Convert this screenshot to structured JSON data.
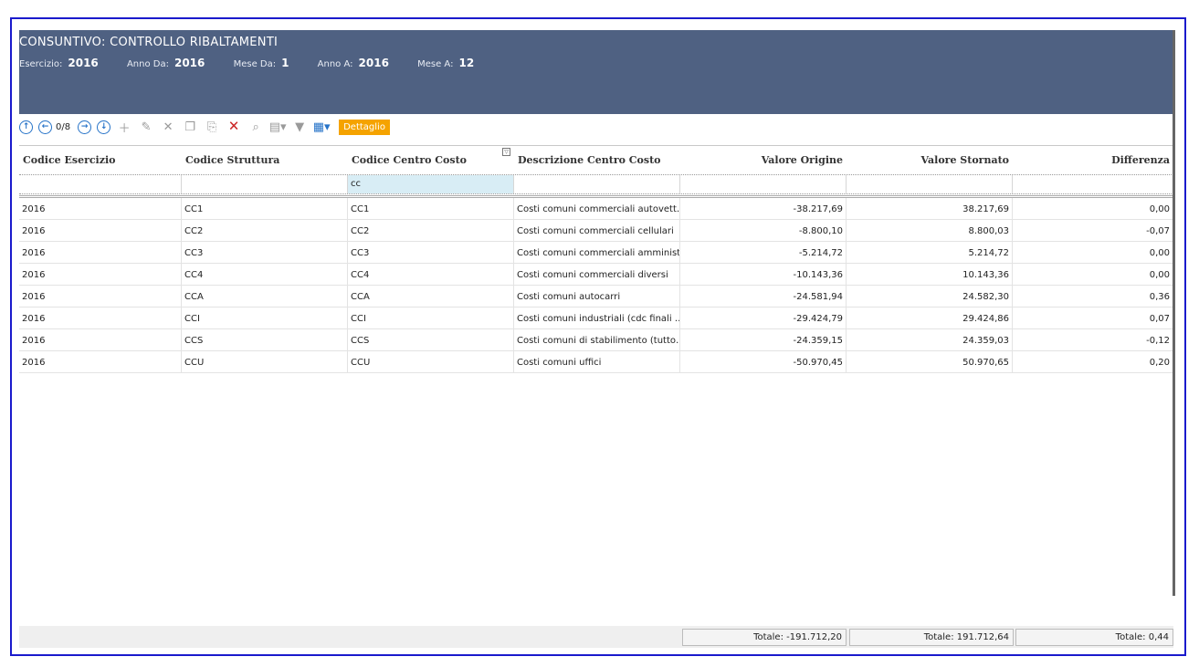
{
  "header": {
    "title": "CONSUNTIVO: CONTROLLO RIBALTAMENTI",
    "params": [
      {
        "label": "Esercizio:",
        "value": "2016"
      },
      {
        "label": "Anno Da:",
        "value": "2016"
      },
      {
        "label": "Mese Da:",
        "value": "1"
      },
      {
        "label": "Anno A:",
        "value": "2016"
      },
      {
        "label": "Mese A:",
        "value": "12"
      }
    ]
  },
  "toolbar": {
    "counter": "0/8",
    "dettaglio_label": "Dettaglio"
  },
  "columns": [
    "Codice Esercizio",
    "Codice Struttura",
    "Codice Centro Costo",
    "Descrizione Centro Costo",
    "Valore Origine",
    "Valore Stornato",
    "Differenza"
  ],
  "filter": {
    "codice_centro_costo": "cc"
  },
  "rows": [
    [
      "2016",
      "CC1",
      "CC1",
      "Costi comuni commerciali autovett…",
      "-38.217,69",
      "38.217,69",
      "0,00"
    ],
    [
      "2016",
      "CC2",
      "CC2",
      "Costi comuni commerciali cellulari",
      "-8.800,10",
      "8.800,03",
      "-0,07"
    ],
    [
      "2016",
      "CC3",
      "CC3",
      "Costi comuni commerciali amminist…",
      "-5.214,72",
      "5.214,72",
      "0,00"
    ],
    [
      "2016",
      "CC4",
      "CC4",
      "Costi comuni commerciali diversi",
      "-10.143,36",
      "10.143,36",
      "0,00"
    ],
    [
      "2016",
      "CCA",
      "CCA",
      "Costi comuni autocarri",
      "-24.581,94",
      "24.582,30",
      "0,36"
    ],
    [
      "2016",
      "CCI",
      "CCI",
      "Costi comuni industriali (cdc finali …",
      "-29.424,79",
      "29.424,86",
      "0,07"
    ],
    [
      "2016",
      "CCS",
      "CCS",
      "Costi comuni di stabilimento (tutto…",
      "-24.359,15",
      "24.359,03",
      "-0,12"
    ],
    [
      "2016",
      "CCU",
      "CCU",
      "Costi comuni uffici",
      "-50.970,45",
      "50.970,65",
      "0,20"
    ]
  ],
  "totals": {
    "valore_origine": "Totale: -191.712,20",
    "valore_stornato": "Totale: 191.712,64",
    "differenza": "Totale: 0,44"
  }
}
